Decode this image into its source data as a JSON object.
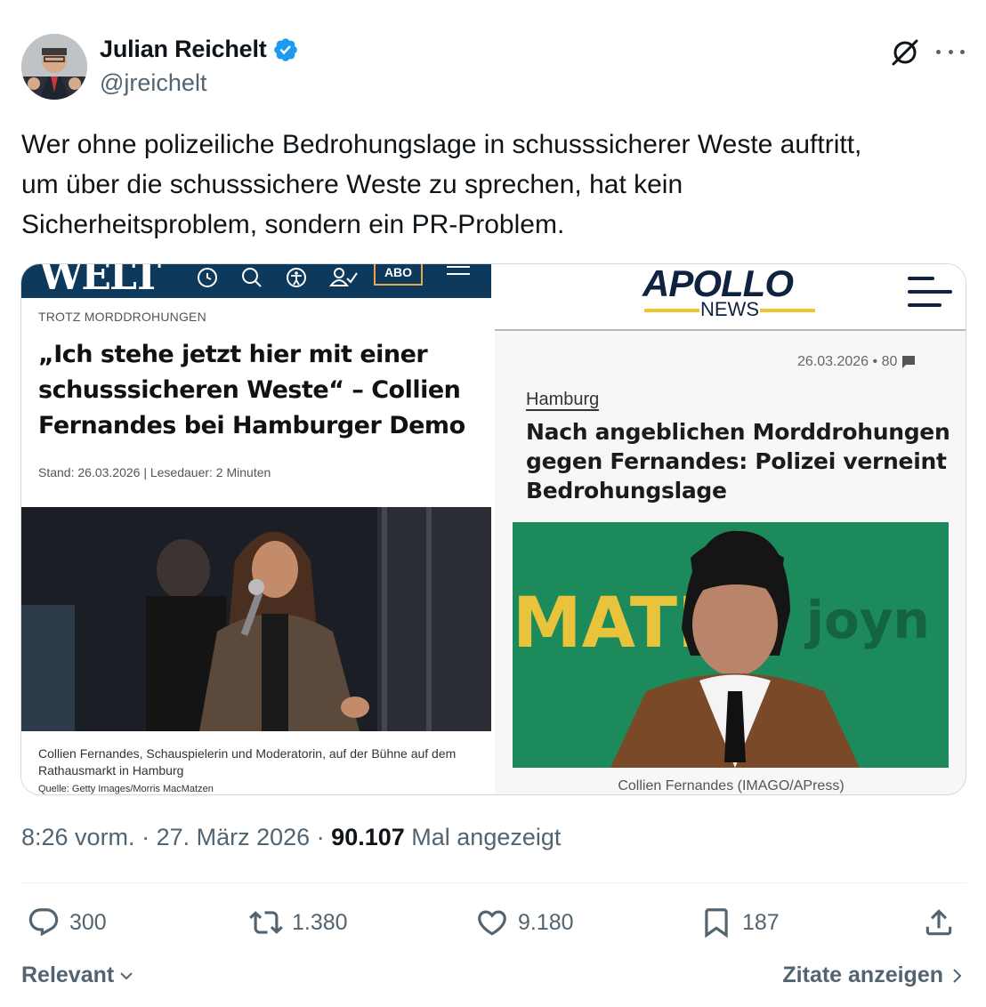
{
  "author": {
    "name": "Julian Reichelt",
    "handle": "@jreichelt",
    "verified_color": "#1d9bf0"
  },
  "tweet": {
    "lines": [
      "Wer ohne polizeiliche Bedrohungslage in schusssicherer Weste auftritt,",
      "um über die schusssichere Weste zu sprechen, hat kein",
      "Sicherheitsproblem, sondern ein PR-Problem."
    ]
  },
  "media": {
    "welt": {
      "logo": "WELT",
      "abo": "ABO",
      "kicker": "TROTZ MORDDROHUNGEN",
      "headline": "„Ich stehe jetzt hier mit einer schusssicheren Weste“ – Collien Fernandes bei Hamburger Demo",
      "meta": "Stand: 26.03.2026 | Lesedauer: 2 Minuten",
      "caption": "Collien Fernandes, Schauspielerin und Moderatorin, auf der Bühne auf dem Rathausmarkt in Hamburg",
      "source": "Quelle: Getty Images/Morris MacMatzen"
    },
    "apollo": {
      "logo": "APOLLO",
      "logo_sub": "NEWS",
      "meta": "26.03.2026 • 80",
      "kicker": "Hamburg",
      "headline": "Nach angeblichen Morddrohungen gegen Fernandes: Polizei verneint Bedrohungslage",
      "photo_text_left": "MATE.",
      "photo_text_right": "joyn",
      "caption": "Collien Fernandes (IMAGO/APress)"
    }
  },
  "timestamp": {
    "time": "8:26 vorm.",
    "date": "27. März 2026",
    "views": "90.107",
    "views_label": "Mal angezeigt"
  },
  "actions": {
    "replies": "300",
    "reposts": "1.380",
    "likes": "9.180",
    "bookmarks": "187"
  },
  "footer": {
    "sort": "Relevant",
    "quotes": "Zitate anzeigen"
  },
  "colors": {
    "text": "#0f1419",
    "secondary": "#536471",
    "welt_blue": "#0d3a5c",
    "apollo_navy": "#0f2341",
    "apollo_yellow": "#f2c230"
  }
}
